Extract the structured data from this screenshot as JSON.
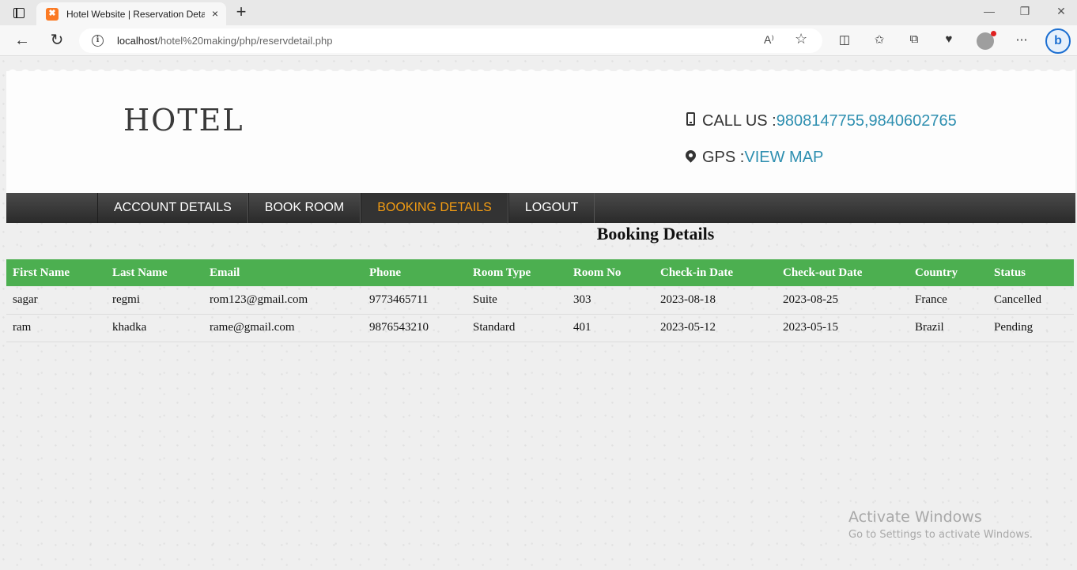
{
  "browser": {
    "tab_title": "Hotel Website | Reservation Deta",
    "tab_close": "×",
    "new_tab": "+",
    "favicon": "✖",
    "url_host": "localhost",
    "url_path": "/hotel%20making/php/reservdetail.php",
    "info_icon": "i",
    "read_aloud": "A⁾",
    "star": "☆",
    "window_controls": {
      "minimize": "—",
      "restore": "❐",
      "close": "✕"
    },
    "nav": {
      "back": "←",
      "refresh": "↻"
    },
    "tools": {
      "split": "◫",
      "favorites": "✩",
      "collections": "⧉",
      "heart": "♥",
      "more": "⋯"
    },
    "bing": "b"
  },
  "site": {
    "logo": "HOTEL",
    "call_label": "CALL US : ",
    "call_numbers": "9808147755,9840602765",
    "gps_label": "GPS : ",
    "gps_link": "VIEW MAP"
  },
  "nav": {
    "items": [
      "ACCOUNT DETAILS",
      "BOOK ROOM",
      "BOOKING DETAILS",
      "LOGOUT"
    ],
    "active_index": 2
  },
  "booking": {
    "title": "Booking Details",
    "columns": [
      "First Name",
      "Last Name",
      "Email",
      "Phone",
      "Room Type",
      "Room No",
      "Check-in Date",
      "Check-out Date",
      "Country",
      "Status"
    ],
    "rows": [
      [
        "sagar",
        "regmi",
        "rom123@gmail.com",
        "9773465711",
        "Suite",
        "303",
        "2023-08-18",
        "2023-08-25",
        "France",
        "Cancelled"
      ],
      [
        "ram",
        "khadka",
        "rame@gmail.com",
        "9876543210",
        "Standard",
        "401",
        "2023-05-12",
        "2023-05-15",
        "Brazil",
        "Pending"
      ]
    ]
  },
  "watermark": {
    "line1": "Activate Windows",
    "line2": "Go to Settings to activate Windows."
  },
  "colors": {
    "table_header": "#4caf50",
    "nav_active": "#f39c12",
    "link": "#2e8fb0"
  }
}
